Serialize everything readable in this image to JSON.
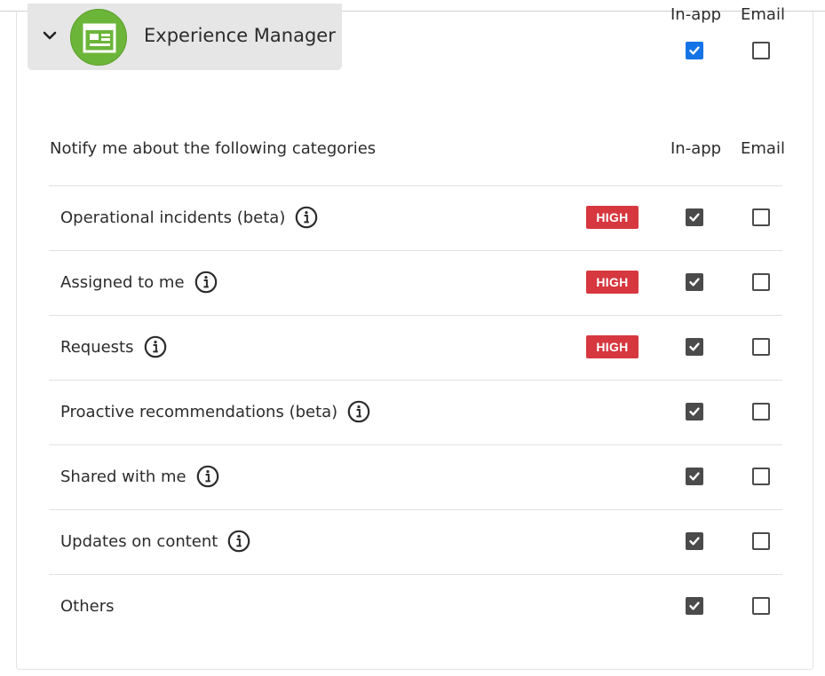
{
  "app": {
    "name": "Experience Manager",
    "logo_icon": "experience-manager-logo-icon",
    "logo_color": "#6bb539",
    "expanded": true
  },
  "app_header_columns": {
    "inapp_label": "In-app",
    "email_label": "Email",
    "inapp_checked": true,
    "email_checked": false
  },
  "categories_section": {
    "title": "Notify me about the following categories",
    "inapp_label": "In-app",
    "email_label": "Email"
  },
  "colors": {
    "badge_high": "#d7373f",
    "checkbox_checked": "#4b4b4b",
    "checkbox_accent": "#1473e6"
  },
  "categories": [
    {
      "label": "Operational incidents (beta)",
      "info": true,
      "badge": "HIGH",
      "inapp": true,
      "email": false
    },
    {
      "label": "Assigned to me",
      "info": true,
      "badge": "HIGH",
      "inapp": true,
      "email": false
    },
    {
      "label": "Requests",
      "info": true,
      "badge": "HIGH",
      "inapp": true,
      "email": false
    },
    {
      "label": "Proactive recommendations (beta)",
      "info": true,
      "badge": "",
      "inapp": true,
      "email": false
    },
    {
      "label": "Shared with me",
      "info": true,
      "badge": "",
      "inapp": true,
      "email": false
    },
    {
      "label": "Updates on content",
      "info": true,
      "badge": "",
      "inapp": true,
      "email": false
    },
    {
      "label": "Others",
      "info": false,
      "badge": "",
      "inapp": true,
      "email": false
    }
  ]
}
